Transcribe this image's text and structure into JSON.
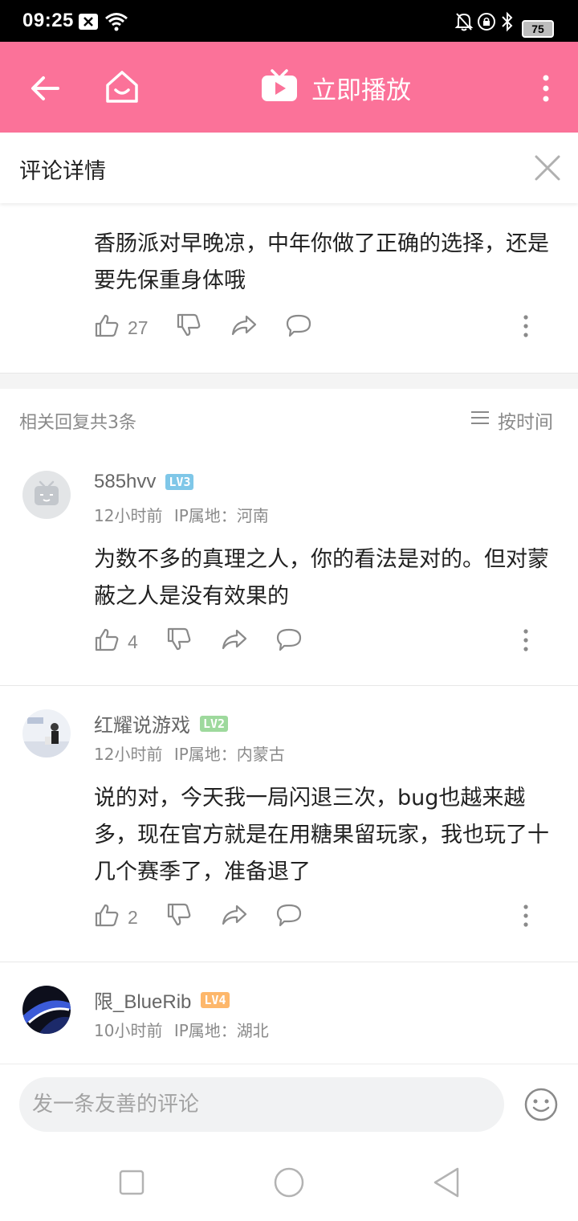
{
  "status_bar": {
    "time": "09:25",
    "battery": "75",
    "icons": [
      "close-box-icon",
      "wifi-icon",
      "mute-bell-icon",
      "lock-rotation-icon",
      "bluetooth-icon",
      "battery-icon"
    ]
  },
  "nav": {
    "title": "立即播放",
    "accent_color": "#fb7299",
    "icons": [
      "back-arrow-icon",
      "home-icon",
      "tv-play-icon",
      "more-vertical-icon"
    ]
  },
  "detail": {
    "title": "评论详情"
  },
  "original_comment": {
    "text": "香肠派对早晚凉，中年你做了正确的选择，还是要先保重身体哦",
    "likes": "27"
  },
  "replies_header": {
    "count_text": "相关回复共3条",
    "sort_label": "按时间"
  },
  "replies": [
    {
      "username": "585hvv",
      "level": "LV3",
      "level_color": "#7fc7e8",
      "time": "12小时前",
      "ip": "IP属地：河南",
      "text": "为数不多的真理之人，你的看法是对的。但对蒙蔽之人是没有效果的",
      "likes": "4"
    },
    {
      "username": "红耀说游戏",
      "level": "LV2",
      "level_color": "#9ed99d",
      "time": "12小时前",
      "ip": "IP属地：内蒙古",
      "text": "说的对，今天我一局闪退三次，bug也越来越多，现在官方就是在用糖果留玩家，我也玩了十几个赛季了，准备退了",
      "likes": "2"
    },
    {
      "username": "限_BlueRib",
      "level": "LV4",
      "level_color": "#fdb76b",
      "time": "10小时前",
      "ip": "IP属地：湖北",
      "text": ""
    }
  ],
  "input": {
    "placeholder": "发一条友善的评论"
  }
}
